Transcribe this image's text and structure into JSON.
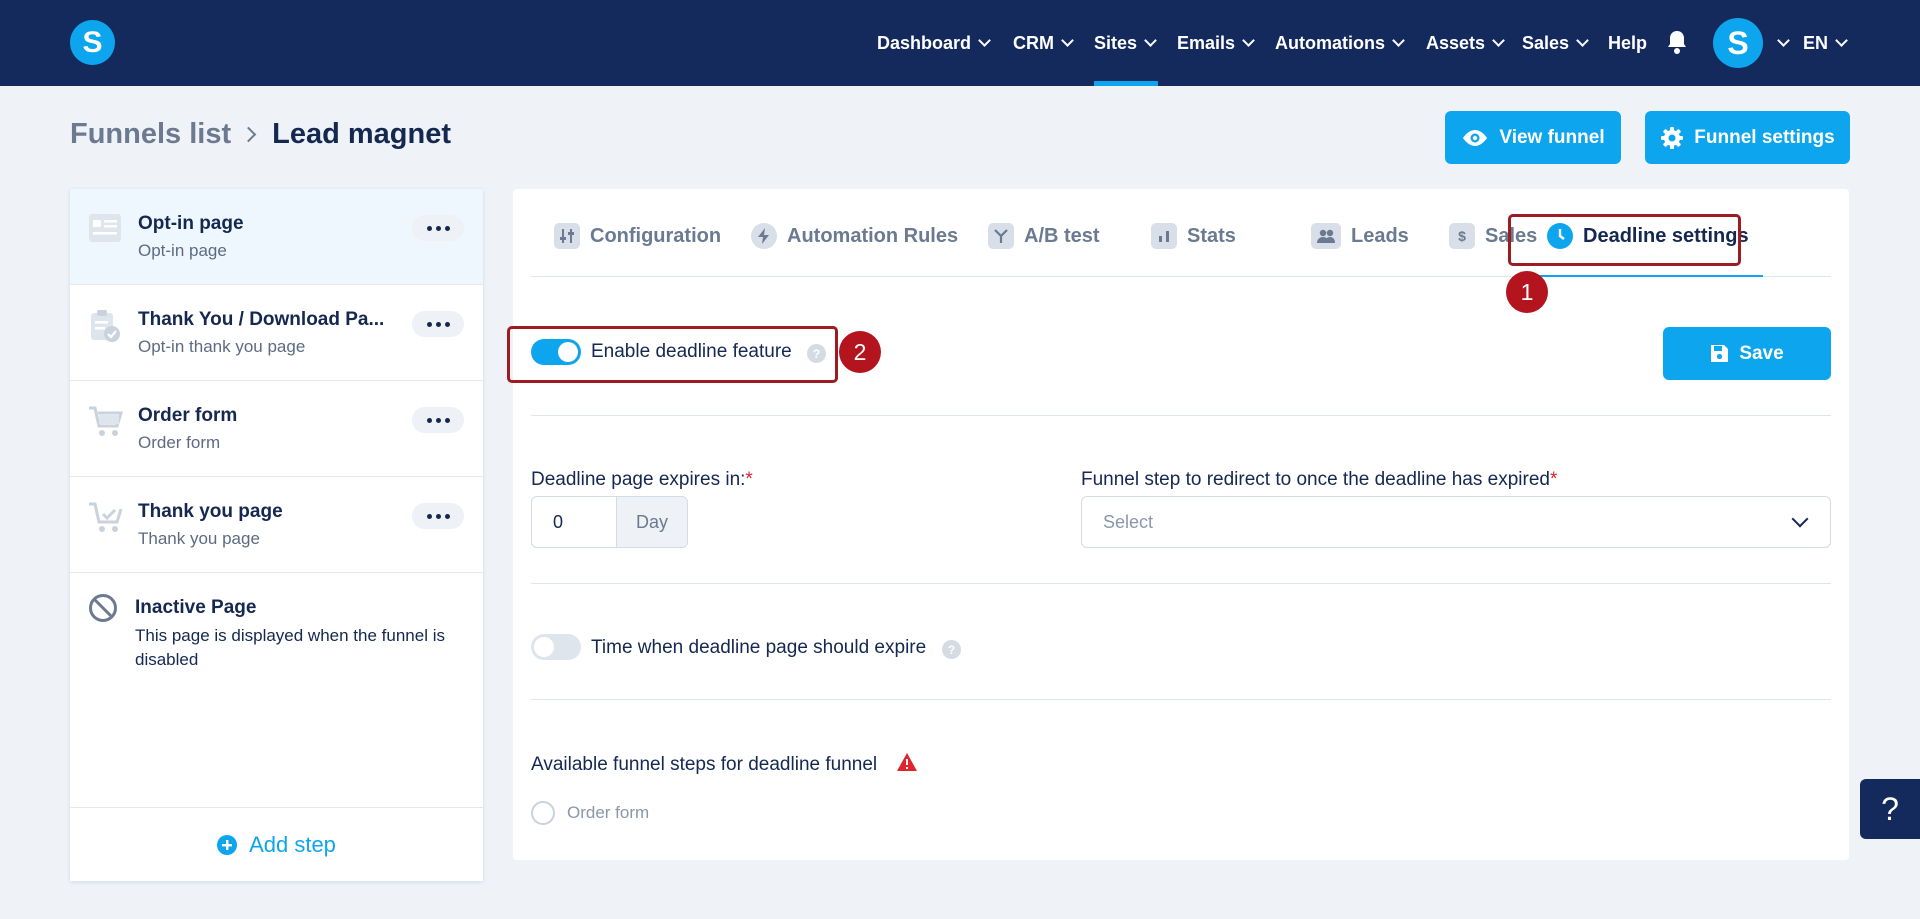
{
  "nav": {
    "logo": "S",
    "items": [
      {
        "label": "Dashboard",
        "dropdown": true
      },
      {
        "label": "CRM",
        "dropdown": true
      },
      {
        "label": "Sites",
        "dropdown": true,
        "active": true
      },
      {
        "label": "Emails",
        "dropdown": true
      },
      {
        "label": "Automations",
        "dropdown": true
      },
      {
        "label": "Assets",
        "dropdown": true
      },
      {
        "label": "Sales",
        "dropdown": true
      },
      {
        "label": "Help",
        "dropdown": false
      }
    ],
    "avatar": "S",
    "language": "EN"
  },
  "breadcrumb": {
    "root": "Funnels list",
    "current": "Lead magnet"
  },
  "header_buttons": {
    "view_funnel": "View funnel",
    "funnel_settings": "Funnel settings"
  },
  "steps": [
    {
      "title": "Opt-in page",
      "subtitle": "Opt-in page",
      "icon": "opt-in-page-icon",
      "active": true
    },
    {
      "title": "Thank You / Download Pa...",
      "subtitle": "Opt-in thank you page",
      "icon": "clipboard-check-icon"
    },
    {
      "title": "Order form",
      "subtitle": "Order form",
      "icon": "cart-icon"
    },
    {
      "title": "Thank you page",
      "subtitle": "Thank you page",
      "icon": "cart-check-icon"
    }
  ],
  "inactive_page": {
    "title": "Inactive Page",
    "description": "This page is displayed when the funnel is disabled"
  },
  "add_step": "Add step",
  "tabs": [
    {
      "label": "Configuration",
      "icon": "sliders-icon"
    },
    {
      "label": "Automation Rules",
      "icon": "bolt-icon"
    },
    {
      "label": "A/B test",
      "icon": "split-icon"
    },
    {
      "label": "Stats",
      "icon": "bar-chart-icon"
    },
    {
      "label": "Leads",
      "icon": "users-icon"
    },
    {
      "label": "Sales",
      "icon": "dollar-icon"
    },
    {
      "label": "Deadline settings",
      "icon": "clock-icon",
      "active": true
    }
  ],
  "annotations": [
    "1",
    "2"
  ],
  "deadline": {
    "enable_label": "Enable deadline feature",
    "enable_on": true,
    "save_label": "Save",
    "expires_label": "Deadline page expires in:",
    "expires_value": "0",
    "expires_unit": "Day",
    "redirect_label": "Funnel step to redirect to once the deadline has expired",
    "redirect_placeholder": "Select",
    "time_label": "Time when deadline page should expire",
    "time_on": false,
    "available_label": "Available funnel steps for deadline funnel",
    "available_option": "Order form"
  },
  "help_fab": "?",
  "colors": {
    "navy": "#142a5c",
    "accent": "#0ea5ef",
    "annotation": "#b3141d"
  }
}
